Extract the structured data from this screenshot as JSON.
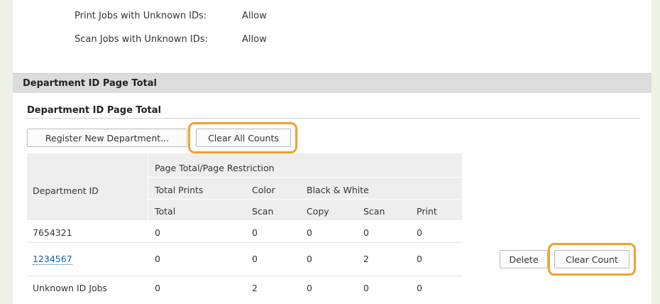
{
  "settings": [
    {
      "label": "Print Jobs with Unknown IDs:",
      "value": "Allow"
    },
    {
      "label": "Scan Jobs with Unknown IDs:",
      "value": "Allow"
    }
  ],
  "section": {
    "title": "Department ID Page Total",
    "subtitle": "Department ID Page Total"
  },
  "toolbar": {
    "register_label": "Register New Department...",
    "clear_all_label": "Clear All Counts"
  },
  "table": {
    "header_dept": "Department ID",
    "header_group": "Page Total/Page Restriction",
    "header_total_prints": "Total Prints",
    "header_color": "Color",
    "header_bw": "Black & White",
    "sub_total": "Total",
    "sub_color_scan": "Scan",
    "sub_copy": "Copy",
    "sub_scan": "Scan",
    "sub_print": "Print",
    "rows": [
      {
        "id": "7654321",
        "total": "0",
        "color_scan": "0",
        "copy": "0",
        "scan": "0",
        "print": "0"
      },
      {
        "id": "1234567",
        "total": "0",
        "color_scan": "0",
        "copy": "0",
        "scan": "2",
        "print": "0"
      },
      {
        "id": "Unknown ID Jobs",
        "total": "0",
        "color_scan": "2",
        "copy": "0",
        "scan": "0",
        "print": "0"
      }
    ]
  },
  "row_actions": {
    "delete_label": "Delete",
    "clear_count_label": "Clear Count"
  },
  "colors": {
    "highlight": "#f0a030",
    "link": "#1a5fb4",
    "header_bg": "#eeeeee",
    "page_bg": "#edf2e6"
  }
}
